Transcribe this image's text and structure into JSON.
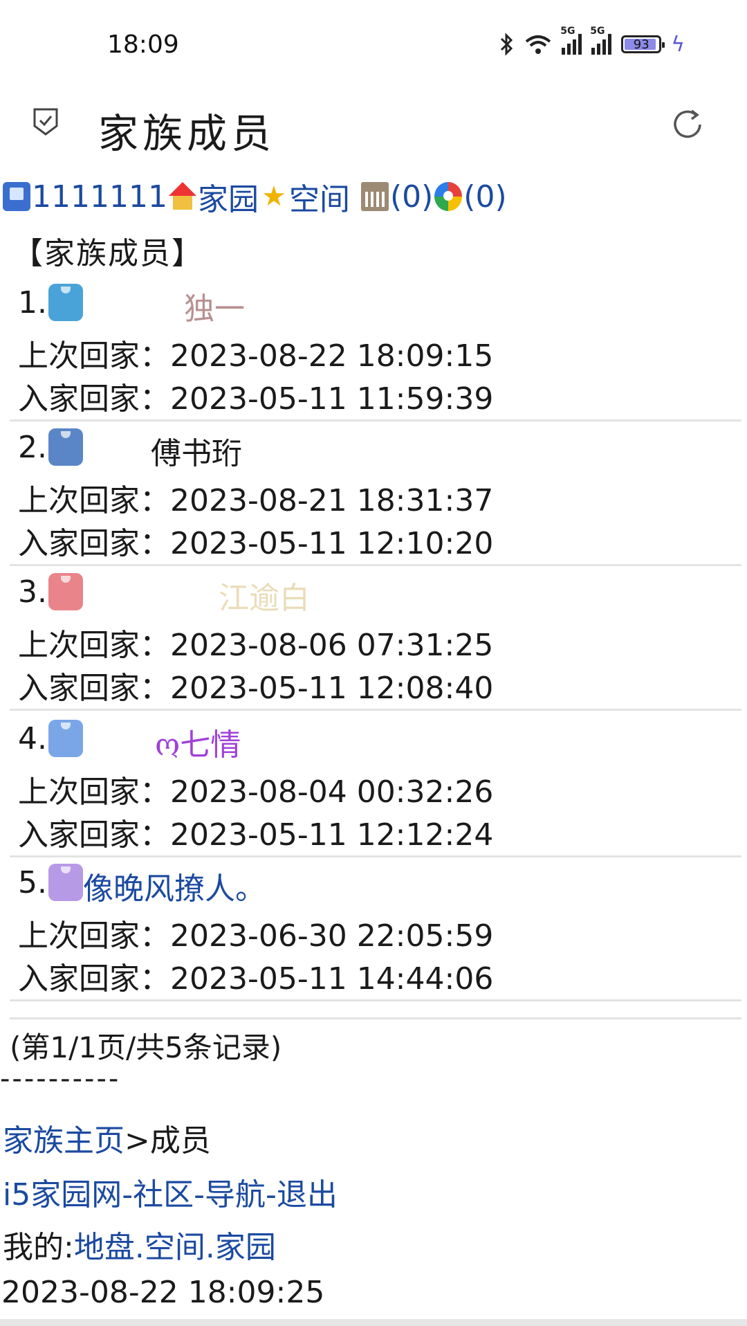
{
  "status_bar": {
    "time": "18:09",
    "network_tag": "5G",
    "battery_level": "93",
    "icons": [
      "bluetooth-icon",
      "wifi-icon",
      "signal-5g-icon",
      "signal-5g-icon",
      "battery-icon",
      "charging-icon"
    ]
  },
  "header": {
    "title": "家族成员"
  },
  "top_links": {
    "user_id": "1111111",
    "home": "家园",
    "space": "空间",
    "building_count": "(0)",
    "wheel_count": "(0)"
  },
  "section_title": "【家族成员】",
  "labels": {
    "last_home": "上次回家：",
    "join_home": "入家回家："
  },
  "members": [
    {
      "index": "1.",
      "name": "独一",
      "name_color": "#b89090",
      "last_home": "2023-08-22 18:09:15",
      "join_home": "2023-05-11 11:59:39",
      "avatar_color": "#4aa3d8"
    },
    {
      "index": "2.",
      "name": "傅书珩",
      "name_color": "#1a1a1a",
      "last_home": "2023-08-21 18:31:37",
      "join_home": "2023-05-11 12:10:20",
      "avatar_color": "#5a86c8"
    },
    {
      "index": "3.",
      "name": "江逾白",
      "name_color": "#eadcb8",
      "last_home": "2023-08-06 07:31:25",
      "join_home": "2023-05-11 12:08:40",
      "avatar_color": "#e9848a"
    },
    {
      "index": "4.",
      "name": "ო七情",
      "name_color": "#a040d8",
      "last_home": "2023-08-04 00:32:26",
      "join_home": "2023-05-11 12:12:24",
      "avatar_color": "#7aa6e8"
    },
    {
      "index": "5.",
      "name": "像晚风撩人。",
      "name_color": "#1b4aa0",
      "last_home": "2023-06-30 22:05:59",
      "join_home": "2023-05-11 14:44:06",
      "avatar_color": "#b79ae6"
    }
  ],
  "pager": "(第1/1页/共5条记录)",
  "dashes": "----------",
  "breadcrumb": {
    "home_link": "家族主页",
    "sep": ">",
    "current": "成员"
  },
  "nav": {
    "site": "i5家园网",
    "sep": "-",
    "community": "社区",
    "navigation": "导航",
    "logout": "退出"
  },
  "mine": {
    "label": "我的:",
    "territory": "地盘",
    "dot": ".",
    "space": "空间",
    "home": "家园"
  },
  "footer_time": "2023-08-22 18:09:25"
}
